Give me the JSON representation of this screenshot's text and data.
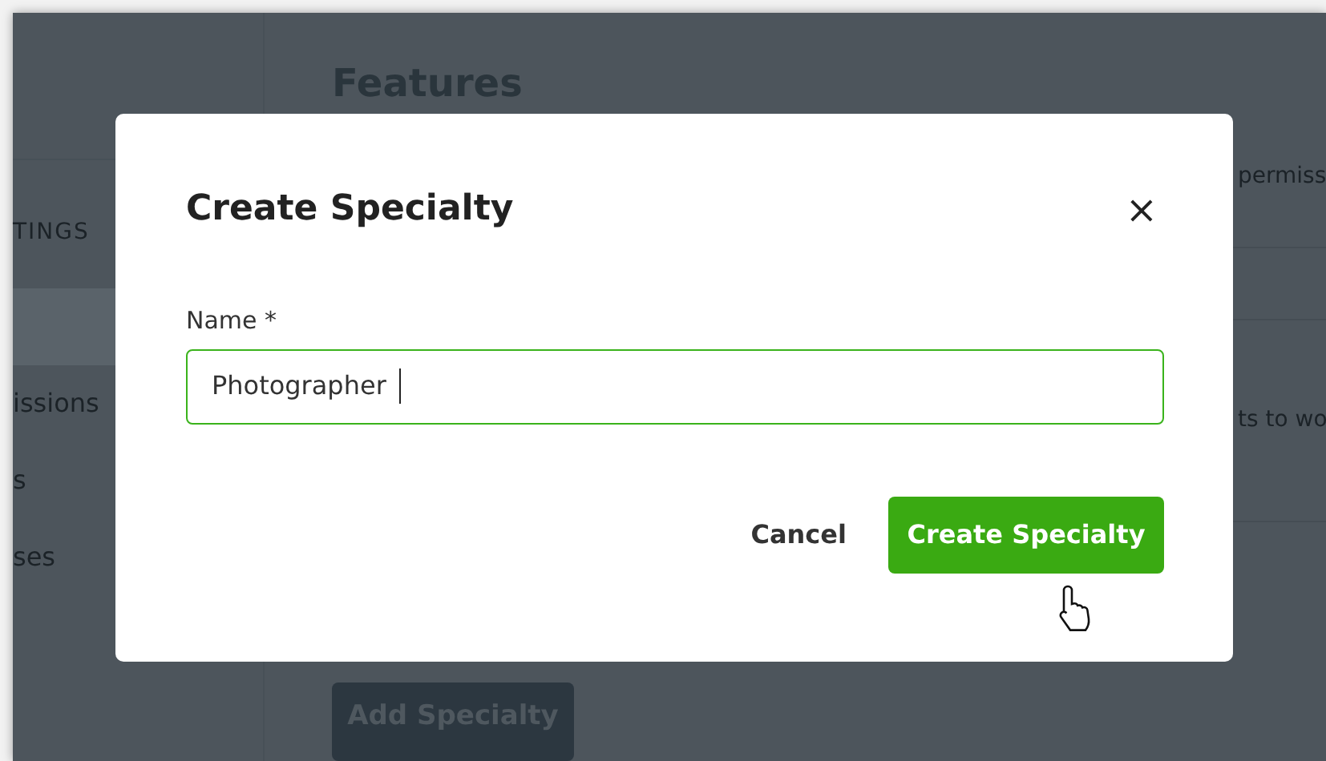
{
  "sidebar": {
    "items": [
      {
        "label": "TINGS",
        "kind": "heading"
      },
      {
        "kind": "item",
        "selected": true
      },
      {
        "label": "issions",
        "kind": "item",
        "selected": false
      },
      {
        "label": "s",
        "kind": "item",
        "selected": false
      },
      {
        "label": "ses",
        "kind": "item",
        "selected": false
      }
    ]
  },
  "main": {
    "title": "Features",
    "rows": [
      {
        "text": "permiss"
      },
      {},
      {
        "text": "ts to wo"
      }
    ],
    "add_button": "Add Specialty"
  },
  "modal": {
    "title": "Create Specialty",
    "close": "×",
    "field": {
      "label": "Name *",
      "value": "Photographer",
      "focused": true
    },
    "buttons": [
      {
        "label": "Cancel",
        "kind": "link"
      },
      {
        "label": "Create Specialty",
        "kind": "primary"
      }
    ]
  }
}
